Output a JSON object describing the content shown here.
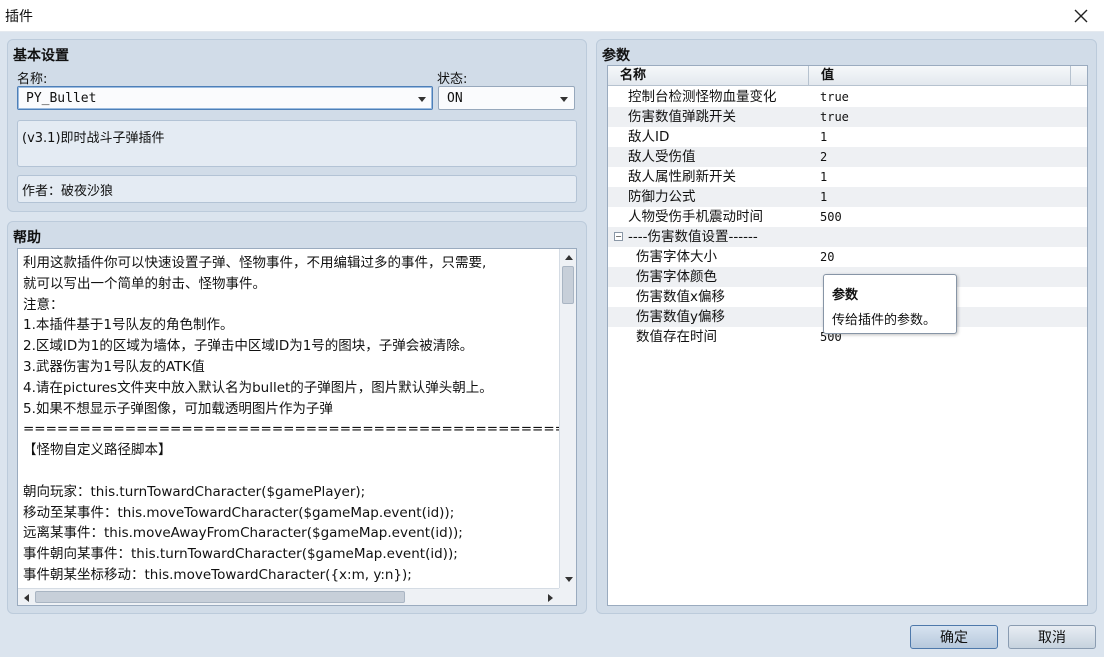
{
  "window": {
    "title": "插件"
  },
  "basic": {
    "header": "基本设置",
    "name_label": "名称:",
    "name_value": "PY_Bullet",
    "status_label": "状态:",
    "status_value": "ON",
    "description": "(v3.1)即时战斗子弹插件",
    "author": "作者：破夜沙狼"
  },
  "help": {
    "header": "帮助",
    "lines": [
      "利用这款插件你可以快速设置子弹、怪物事件，不用编辑过多的事件，只需要,",
      "就可以写出一个简单的射击、怪物事件。",
      "注意：",
      "1.本插件基于1号队友的角色制作。",
      "2.区域ID为1的区域为墙体，子弹击中区域ID为1号的图块，子弹会被清除。",
      "3.武器伤害为1号队友的ATK值",
      "4.请在pictures文件夹中放入默认名为bullet的子弹图片，图片默认弹头朝上。",
      "5.如果不想显示子弹图像，可加载透明图片作为子弹",
      "=====================================================================",
      "【怪物自定义路径脚本】",
      "",
      "朝向玩家：this.turnTowardCharacter($gamePlayer);",
      "移动至某事件：this.moveTowardCharacter($gameMap.event(id));",
      "远离某事件：this.moveAwayFromCharacter($gameMap.event(id));",
      "事件朝向某事件：this.turnTowardCharacter($gameMap.event(id));",
      "事件朝某坐标移动：this.moveTowardCharacter({x:m, y:n});"
    ]
  },
  "params": {
    "header": "参数",
    "col_name": "名称",
    "col_value": "值",
    "rows": [
      {
        "name": "控制台检测怪物血量变化",
        "value": "true"
      },
      {
        "name": "伤害数值弹跳开关",
        "value": "true"
      },
      {
        "name": "敌人ID",
        "value": "1"
      },
      {
        "name": "敌人受伤值",
        "value": "2"
      },
      {
        "name": "敌人属性刷新开关",
        "value": "1"
      },
      {
        "name": "防御力公式",
        "value": "1"
      },
      {
        "name": "人物受伤手机震动时间",
        "value": "500"
      },
      {
        "name": "----伤害数值设置------",
        "value": ""
      },
      {
        "name": "伤害字体大小",
        "value": "20"
      },
      {
        "name": "伤害字体颜色",
        "value": ""
      },
      {
        "name": "伤害数值x偏移",
        "value": ""
      },
      {
        "name": "伤害数值y偏移",
        "value": ""
      },
      {
        "name": "数值存在时间",
        "value": "500"
      }
    ],
    "group_toggle": "−"
  },
  "tooltip": {
    "title": "参数",
    "text": "传给插件的参数。"
  },
  "buttons": {
    "ok": "确定",
    "cancel": "取消"
  }
}
